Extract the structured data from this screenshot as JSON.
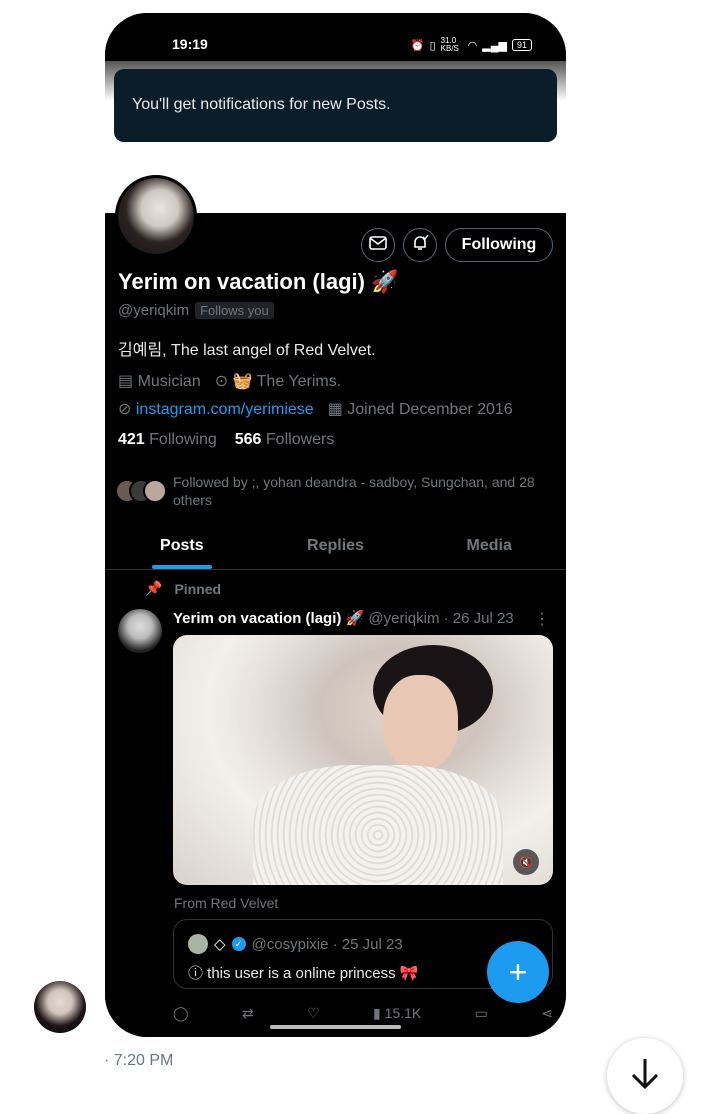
{
  "status_bar": {
    "time": "19:19",
    "net_speed": "31.0 KB/S",
    "battery": "91"
  },
  "toast": {
    "text": "You'll get notifications for new Posts."
  },
  "profile": {
    "follow_label": "Following",
    "name": "Yerim on vacation (lagi) 🚀",
    "handle": "@yeriqkim",
    "follows_you": "Follows you",
    "bio": "김예림, The last angel of Red Velvet.",
    "category": "Musician",
    "location": "🧺 The Yerims.",
    "link": "instagram.com/yerimiese",
    "joined": "Joined December 2016",
    "following_count": "421",
    "following_label": "Following",
    "followers_count": "566",
    "followers_label": "Followers",
    "followed_by": "Followed by ;, yohan deandra - sadboy, Sungchan, and 28 others"
  },
  "tabs": [
    "Posts",
    "Replies",
    "Media"
  ],
  "post": {
    "pinned_label": "Pinned",
    "author": "Yerim on vacation (lagi) 🚀",
    "meta": "@yeriqkim · 26 Jul 23",
    "from_label": "From Red Velvet",
    "quote_handle": "@cosypixie · 25 Jul 23",
    "quote_text": "ⓘ this user is a online princess 🎀",
    "views": "15.1K"
  },
  "chat": {
    "timestamp": "· 7:20 PM"
  },
  "colors": {
    "accent": "#1d9bf0",
    "toast_bg": "#0c1d2a"
  }
}
